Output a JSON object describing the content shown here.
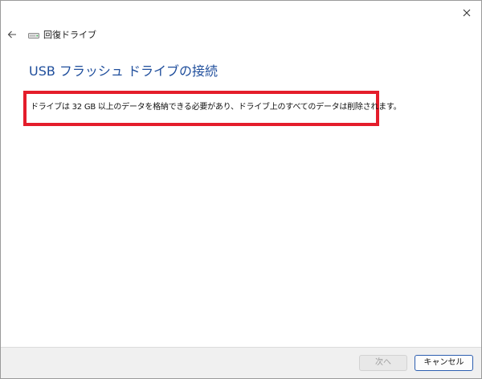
{
  "window": {
    "app_title": "回復ドライブ",
    "close_icon": "close-icon",
    "back_icon": "back-arrow-icon",
    "drive_icon": "drive-icon"
  },
  "main": {
    "page_title": "USB フラッシュ ドライブの接続",
    "message": "ドライブは 32 GB 以上のデータを格納できる必要があり、ドライブ上のすべてのデータは削除されます。"
  },
  "footer": {
    "next_label": "次へ",
    "cancel_label": "キャンセル"
  },
  "colors": {
    "title_blue": "#1f4e9c",
    "highlight_red": "#e41d2b",
    "accent_border": "#2d5fb0"
  }
}
